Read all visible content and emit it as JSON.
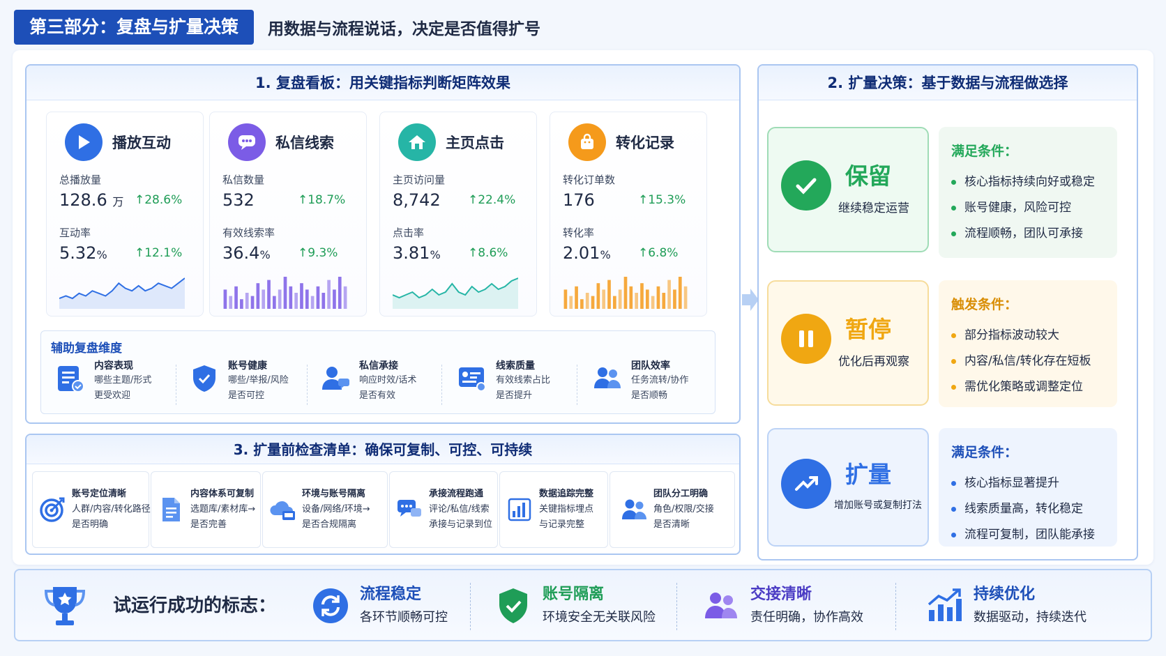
{
  "header": {
    "section_tag": "第三部分：复盘与扩量决策",
    "subtitle": "用数据与流程说话，决定是否值得扩号"
  },
  "panel1": {
    "title": "1. 复盘看板：用关键指标判断矩阵效果",
    "metrics": [
      {
        "title": "播放互动",
        "icon": "play-icon",
        "color": "#2f6fe4",
        "label1": "总播放量",
        "value1": "128.6",
        "unit1": "万",
        "change1": "↑28.6%",
        "label2": "互动率",
        "value2": "5.32",
        "unit2": "%",
        "change2": "↑12.1%",
        "chart": "area",
        "series": [
          3,
          4,
          3,
          5,
          4,
          6,
          5,
          4,
          6,
          9,
          7,
          6,
          8,
          6,
          7,
          9,
          8,
          7,
          9,
          11
        ]
      },
      {
        "title": "私信线索",
        "icon": "chat-icon",
        "color": "#7b5ce6",
        "label1": "私信数量",
        "value1": "532",
        "unit1": "",
        "change1": "↑18.7%",
        "label2": "有效线索率",
        "value2": "36.4",
        "unit2": "%",
        "change2": "↑9.3%",
        "chart": "bar",
        "series": [
          6,
          4,
          7,
          3,
          5,
          4,
          8,
          6,
          9,
          4,
          6,
          10,
          7,
          5,
          8,
          6,
          4,
          7,
          5,
          9,
          6,
          10,
          7
        ]
      },
      {
        "title": "主页点击",
        "icon": "home-icon",
        "color": "#26b5a6",
        "label1": "主页访问量",
        "value1": "8,742",
        "unit1": "",
        "change1": "↑22.4%",
        "label2": "点击率",
        "value2": "3.81",
        "unit2": "%",
        "change2": "↑8.6%",
        "chart": "area",
        "series": [
          4,
          3,
          4,
          5,
          3,
          4,
          6,
          4,
          5,
          8,
          5,
          4,
          7,
          5,
          6,
          8,
          6,
          7,
          9,
          10
        ]
      },
      {
        "title": "转化记录",
        "icon": "bag-icon",
        "color": "#f59a1b",
        "label1": "转化订单数",
        "value1": "176",
        "unit1": "",
        "change1": "↑15.3%",
        "label2": "转化率",
        "value2": "2.01",
        "unit2": "%",
        "change2": "↑6.8%",
        "chart": "bar",
        "series": [
          6,
          4,
          7,
          3,
          5,
          4,
          8,
          6,
          9,
          4,
          6,
          10,
          7,
          5,
          8,
          6,
          4,
          7,
          5,
          9,
          6,
          10,
          7
        ]
      }
    ],
    "aux": {
      "title": "辅助复盘维度",
      "items": [
        {
          "title": "内容表现",
          "line1": "哪些主题/形式",
          "line2": "更受欢迎",
          "icon": "content-report-icon"
        },
        {
          "title": "账号健康",
          "line1": "哪些/举报/风险",
          "line2": "是否可控",
          "icon": "shield-check-icon"
        },
        {
          "title": "私信承接",
          "line1": "响应时效/话术",
          "line2": "是否有效",
          "icon": "user-chat-icon"
        },
        {
          "title": "线索质量",
          "line1": "有效线索占比",
          "line2": "是否提升",
          "icon": "lead-card-icon"
        },
        {
          "title": "团队效率",
          "line1": "任务流转/协作",
          "line2": "是否顺畅",
          "icon": "team-icon"
        }
      ]
    }
  },
  "panel2": {
    "title": "2. 扩量决策：基于数据与流程做选择",
    "decisions": [
      {
        "name": "保留",
        "sub": "继续稳定运营",
        "icon": "check-icon",
        "cond_title": "满足条件：",
        "conds": [
          "核心指标持续向好或稳定",
          "账号健康，风险可控",
          "流程顺畅，团队可承接"
        ]
      },
      {
        "name": "暂停",
        "sub": "优化后再观察",
        "icon": "pause-icon",
        "cond_title": "触发条件：",
        "conds": [
          "部分指标波动较大",
          "内容/私信/转化存在短板",
          "需优化策略或调整定位"
        ]
      },
      {
        "name": "扩量",
        "sub": "增加账号或复制打法",
        "icon": "trend-up-icon",
        "cond_title": "满足条件：",
        "conds": [
          "核心指标显著提升",
          "线索质量高，转化稳定",
          "流程可复制，团队能承接"
        ]
      }
    ]
  },
  "panel3": {
    "title": "3. 扩量前检查清单：确保可复制、可控、可持续",
    "items": [
      {
        "title": "账号定位清晰",
        "line1": "人群/内容/转化路径",
        "line2": "是否明确",
        "icon": "target-icon"
      },
      {
        "title": "内容体系可复制",
        "line1": "选题库/素材库→",
        "line2": "是否完善",
        "icon": "document-icon"
      },
      {
        "title": "环境与账号隔离",
        "line1": "设备/网络/环境→",
        "line2": "是否合规隔离",
        "icon": "cloud-device-icon"
      },
      {
        "title": "承接流程跑通",
        "line1": "评论/私信/线索",
        "line2": "承接与记录到位",
        "icon": "chat-bubbles-icon"
      },
      {
        "title": "数据追踪完整",
        "line1": "关键指标埋点",
        "line2": "与记录完整",
        "icon": "bar-chart-icon"
      },
      {
        "title": "团队分工明确",
        "line1": "角色/权限/交接",
        "line2": "是否清晰",
        "icon": "team-icon"
      }
    ]
  },
  "footer": {
    "title": "试运行成功的标志：",
    "items": [
      {
        "title": "流程稳定",
        "desc": "各环节顺畅可控",
        "icon": "cycle-icon"
      },
      {
        "title": "账号隔离",
        "desc": "环境安全无关联风险",
        "icon": "shield-check-icon"
      },
      {
        "title": "交接清晰",
        "desc": "责任明确，协作高效",
        "icon": "team-icon"
      },
      {
        "title": "持续优化",
        "desc": "数据驱动，持续迭代",
        "icon": "growth-chart-icon"
      }
    ]
  },
  "colors": {
    "primary": "#1d4fb8",
    "up": "#1f9d57",
    "keep": "#23a85a",
    "pause": "#f0a712",
    "expand": "#2f6fe4"
  }
}
